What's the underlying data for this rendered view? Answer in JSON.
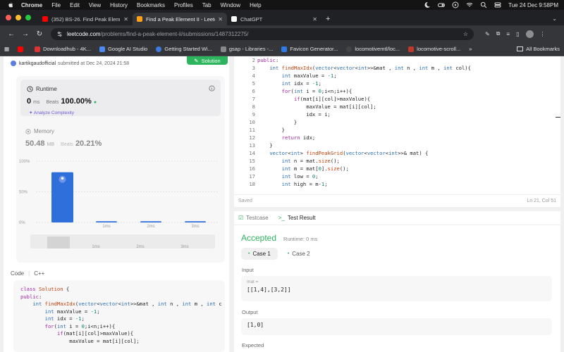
{
  "menubar": {
    "app": "Chrome",
    "items": [
      "File",
      "Edit",
      "View",
      "History",
      "Bookmarks",
      "Profiles",
      "Tab",
      "Window",
      "Help"
    ],
    "datetime": "Tue 24 Dec  9:58PM"
  },
  "tabs": [
    {
      "title": "(352) BS-26. Find Peak Elem...",
      "color": "#ff0000",
      "active": false
    },
    {
      "title": "Find a Peak Element II - Leetc...",
      "color": "#ffa116",
      "active": true
    },
    {
      "title": "ChatGPT",
      "color": "#ffffff",
      "active": false
    }
  ],
  "address": {
    "host": "leetcode.com",
    "path": "/problems/find-a-peak-element-ii/submissions/1487312275/"
  },
  "bookmarks": {
    "items": [
      {
        "label": "",
        "color": "#ff0000"
      },
      {
        "label": "Downloadhub - 4K...",
        "color": "#d33"
      },
      {
        "label": "Google AI Studio",
        "color": "#4a8af4"
      },
      {
        "label": "Getting Started Wi...",
        "color": "#3d7be0"
      },
      {
        "label": "gsap - Libraries -...",
        "color": "#888"
      },
      {
        "label": "Favicon Generator...",
        "color": "#2e7be6"
      },
      {
        "label": "locomotivemtl/loc...",
        "color": "#444"
      },
      {
        "label": "locomotive-scroll...",
        "color": "#c0392b"
      }
    ],
    "all_label": "All Bookmarks"
  },
  "submission": {
    "author": "kartikgaudofficial",
    "submitted": "submitted at Dec 24, 2024 21:58",
    "solution_button": "Solution",
    "runtime_label": "Runtime",
    "runtime_value": "0",
    "runtime_unit": "ms",
    "beats_label": "Beats",
    "runtime_beats": "100.00%",
    "analyze": "Analyze Complexity",
    "memory_label": "Memory",
    "memory_value": "50.48",
    "memory_unit": "MB",
    "memory_beats": "20.21%",
    "code_label": "Code",
    "language": "C++"
  },
  "chart_data": {
    "type": "bar",
    "categories": [
      "",
      "1ms",
      "2ms",
      "3ms"
    ],
    "values": [
      82,
      2,
      2,
      2
    ],
    "yticks": [
      "100%",
      "50%",
      "0%"
    ],
    "ylim": [
      0,
      100
    ],
    "highlight_index": 0,
    "minimap_labels": [
      "1ms",
      "2ms",
      "3ms"
    ]
  },
  "editor": {
    "line_numbers": [
      "2",
      "3",
      "4",
      "5",
      "6",
      "7",
      "8",
      "9",
      "10",
      "11",
      "12",
      "13",
      "14",
      "15",
      "16",
      "17",
      "18"
    ],
    "status_saved": "Saved",
    "status_position": "Ln 21, Col 51"
  },
  "result": {
    "tab_testcase": "Testcase",
    "tab_result": "Test Result",
    "status": "Accepted",
    "runtime": "Runtime: 0 ms",
    "case1": "Case 1",
    "case2": "Case 2",
    "input_label": "Input",
    "input_var": "mat =",
    "input_value": "[[1,4],[3,2]]",
    "output_label": "Output",
    "output_value": "[1,0]",
    "expected_label": "Expected"
  },
  "colors": {
    "accent_green": "#2db55d",
    "bar_blue": "#2f6fdb",
    "purple": "#6b5bd6"
  }
}
